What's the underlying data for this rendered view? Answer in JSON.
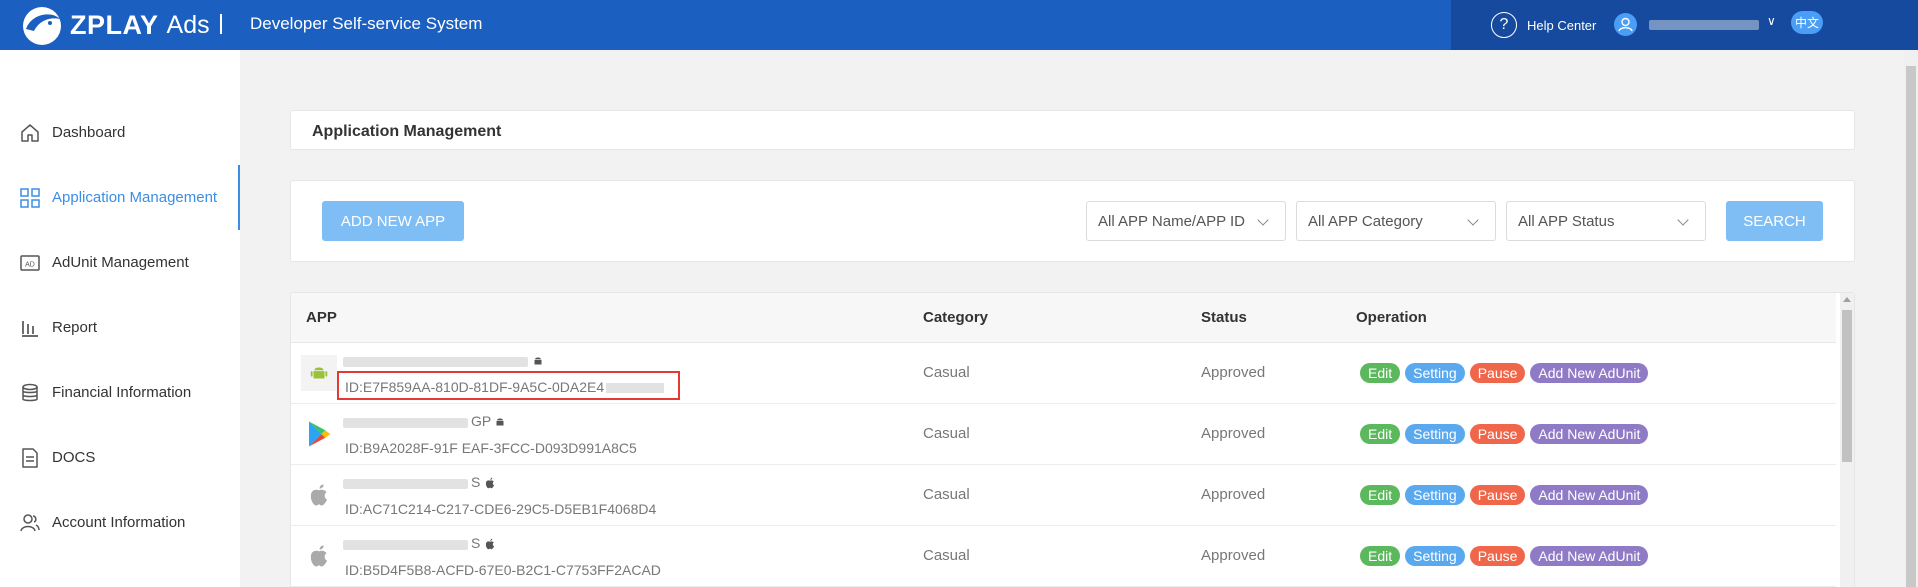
{
  "header": {
    "logo_text": "ZPLAY",
    "logo_suffix": "Ads",
    "system_title": "Developer Self-service System",
    "help_label": "Help Center",
    "help_icon": "question-circle-icon",
    "user_icon": "user-icon",
    "lang_label": "中文"
  },
  "sidebar": {
    "items": [
      {
        "label": "Dashboard",
        "icon": "home-icon"
      },
      {
        "label": "Application Management",
        "icon": "grid-icon",
        "active": true
      },
      {
        "label": "AdUnit Management",
        "icon": "ad-icon"
      },
      {
        "label": "Report",
        "icon": "bar-chart-icon"
      },
      {
        "label": "Financial Information",
        "icon": "database-icon"
      },
      {
        "label": "DOCS",
        "icon": "document-icon"
      },
      {
        "label": "Account Information",
        "icon": "users-icon"
      }
    ]
  },
  "page": {
    "title": "Application Management"
  },
  "toolbar": {
    "add_label": "ADD NEW APP",
    "filter_name": "All APP Name/APP ID",
    "filter_category": "All APP Category",
    "filter_status": "All APP Status",
    "search_label": "SEARCH"
  },
  "table": {
    "columns": [
      "APP",
      "Category",
      "Status",
      "Operation"
    ],
    "rows": [
      {
        "icon": "android-app-icon",
        "platform": "android-icon",
        "name_suffix": "",
        "id": "ID:E7F859AA-810D-81DF-9A5C-0DA2E4",
        "category": "Casual",
        "status": "Approved"
      },
      {
        "icon": "google-play-icon",
        "platform": "android-icon",
        "name_suffix": "GP",
        "id": "ID:B9A2028F-91F   EAF-3FCC-D093D991A8C5",
        "category": "Casual",
        "status": "Approved"
      },
      {
        "icon": "apple-app-icon",
        "platform": "apple-icon",
        "name_suffix": "S",
        "id": "ID:AC71C214-C217-CDE6-29C5-D5EB1F4068D4",
        "category": "Casual",
        "status": "Approved"
      },
      {
        "icon": "apple-app-icon",
        "platform": "apple-icon",
        "name_suffix": "S",
        "id": "ID:B5D4F5B8-ACFD-67E0-B2C1-C7753FF2ACAD",
        "category": "Casual",
        "status": "Approved"
      }
    ],
    "operations": {
      "edit": "Edit",
      "setting": "Setting",
      "pause": "Pause",
      "add_adunit": "Add New AdUnit"
    }
  },
  "colors": {
    "header": "#1b5fc1",
    "accent": "#3a8ee6",
    "edit": "#5cb85c",
    "setting": "#5aa9ef",
    "pause": "#f0664a",
    "add": "#8f7ac6"
  }
}
